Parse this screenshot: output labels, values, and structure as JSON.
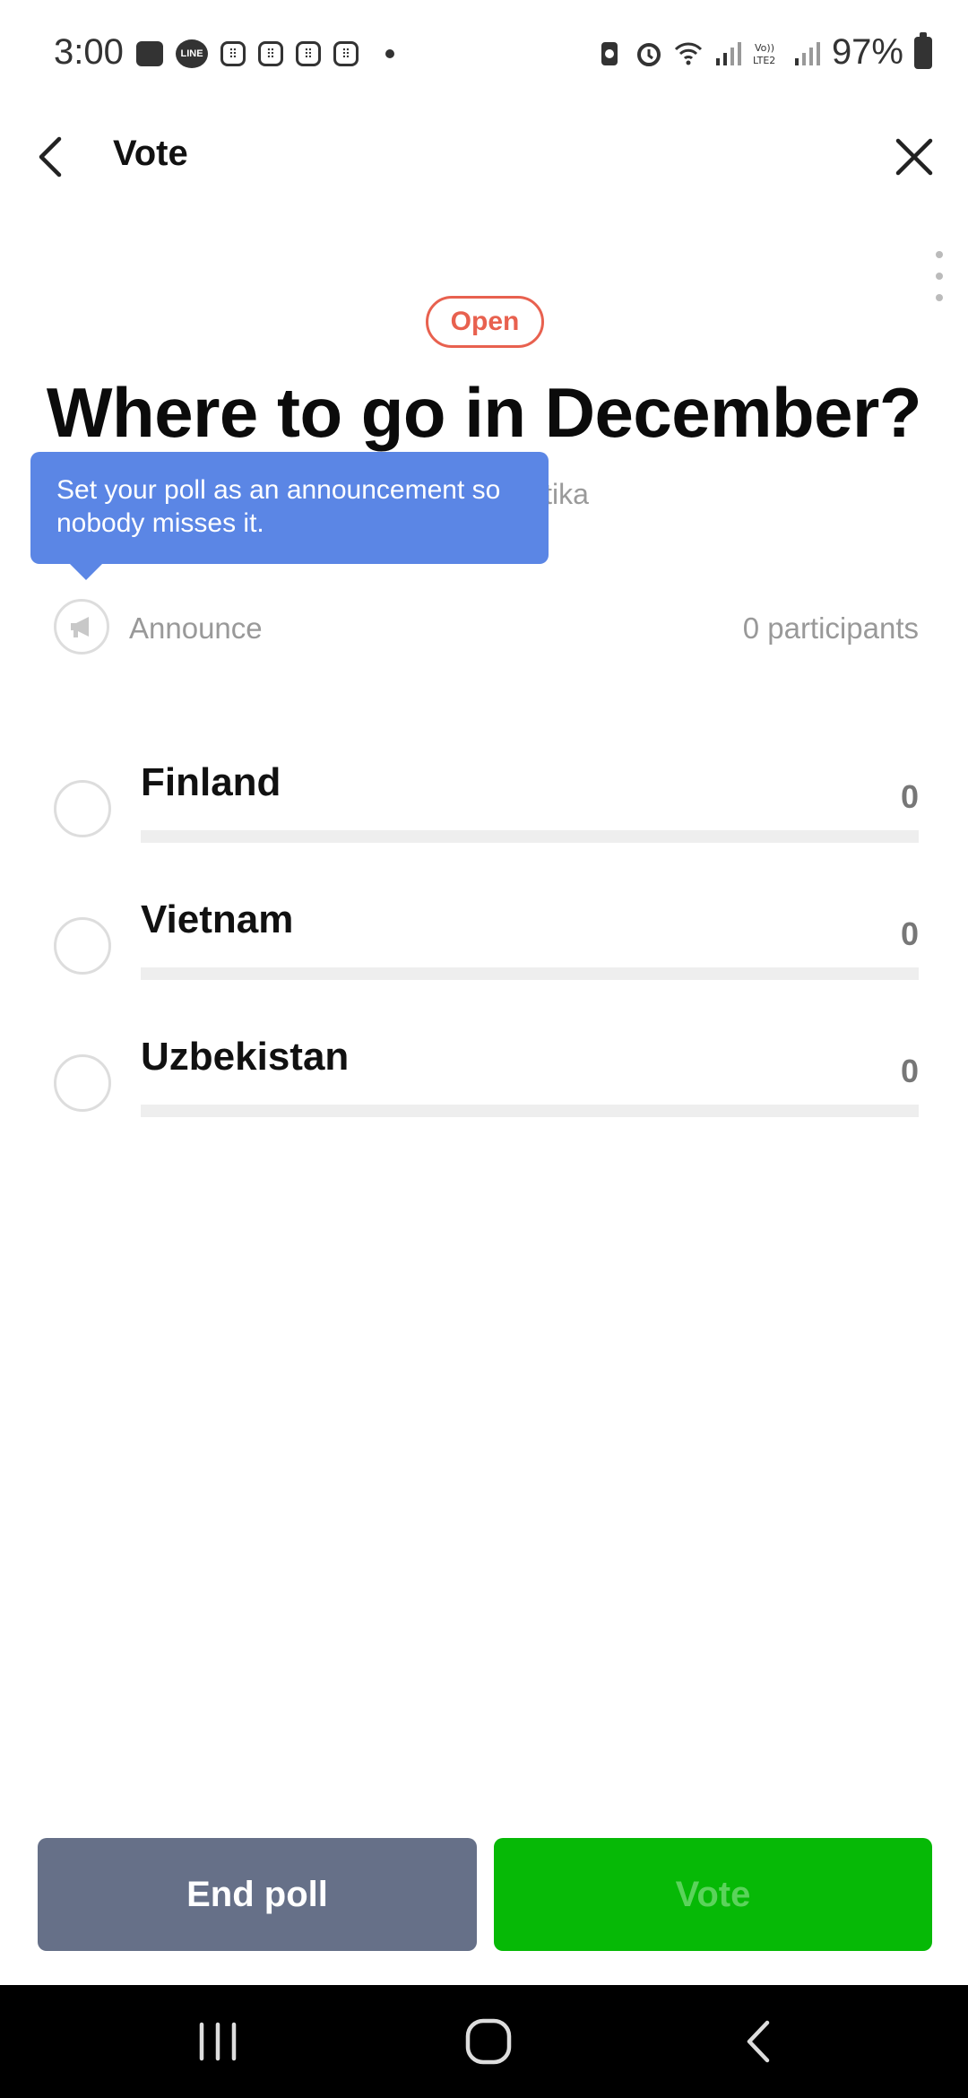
{
  "status_bar": {
    "time": "3:00",
    "battery_pct": "97%",
    "icons_left": [
      "message-icon",
      "line-icon",
      "grid-app-icon",
      "grid-app-icon",
      "grid-app-icon",
      "grid-app-icon",
      "dot-icon"
    ],
    "icons_right": [
      "battery-saver-icon",
      "alarm-icon",
      "wifi-icon",
      "signal-icon",
      "volte-lte2-icon",
      "signal-icon",
      "battery-icon"
    ]
  },
  "header": {
    "title": "Vote",
    "back_icon": "chevron-left-icon",
    "close_icon": "close-icon"
  },
  "poll": {
    "status": "Open",
    "title": "Where to go in December?",
    "creator_fragment": "itika",
    "tooltip": "Set your poll as an announcement so nobody misses it.",
    "announce_label": "Announce",
    "participants": "0 participants",
    "options": [
      {
        "label": "Finland",
        "count": "0",
        "share": 0
      },
      {
        "label": "Vietnam",
        "count": "0",
        "share": 0
      },
      {
        "label": "Uzbekistan",
        "count": "0",
        "share": 0
      }
    ]
  },
  "actions": {
    "end_poll": "End poll",
    "vote": "Vote"
  },
  "colors": {
    "accent_green": "#06b906",
    "open_badge": "#e8614f",
    "tooltip_bg": "#5b86e5",
    "end_poll_bg": "#667088"
  }
}
